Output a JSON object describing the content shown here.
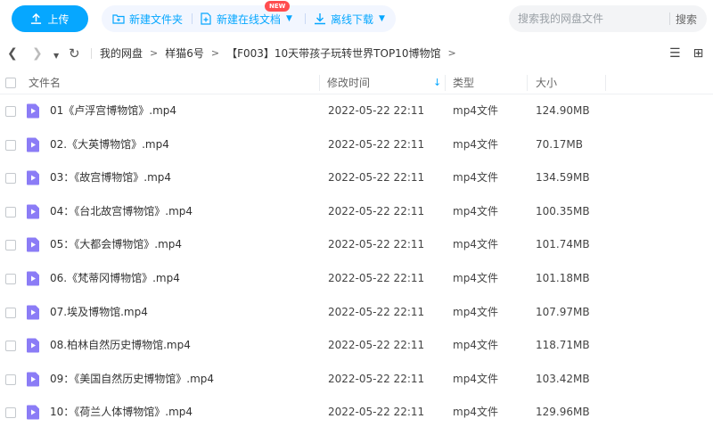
{
  "toolbar": {
    "upload_label": "上传",
    "new_folder_label": "新建文件夹",
    "new_doc_label": "新建在线文档",
    "new_badge": "NEW",
    "offline_label": "离线下载",
    "search_placeholder": "搜索我的网盘文件",
    "search_button": "搜索"
  },
  "breadcrumb": [
    "我的网盘",
    "样猫6号",
    "【F003】10天带孩子玩转世界TOP10博物馆"
  ],
  "columns": {
    "name": "文件名",
    "time": "修改时间",
    "type": "类型",
    "size": "大小"
  },
  "files": [
    {
      "name": "01《卢浮宫博物馆》.mp4",
      "time": "2022-05-22 22:11",
      "type": "mp4文件",
      "size": "124.90MB"
    },
    {
      "name": "02.《大英博物馆》.mp4",
      "time": "2022-05-22 22:11",
      "type": "mp4文件",
      "size": "70.17MB"
    },
    {
      "name": "03：《故宫博物馆》.mp4",
      "time": "2022-05-22 22:11",
      "type": "mp4文件",
      "size": "134.59MB"
    },
    {
      "name": "04：《台北故宫博物馆》.mp4",
      "time": "2022-05-22 22:11",
      "type": "mp4文件",
      "size": "100.35MB"
    },
    {
      "name": "05：《大都会博物馆》.mp4",
      "time": "2022-05-22 22:11",
      "type": "mp4文件",
      "size": "101.74MB"
    },
    {
      "name": "06.《梵蒂冈博物馆》.mp4",
      "time": "2022-05-22 22:11",
      "type": "mp4文件",
      "size": "101.18MB"
    },
    {
      "name": "07.埃及博物馆.mp4",
      "time": "2022-05-22 22:11",
      "type": "mp4文件",
      "size": "107.97MB"
    },
    {
      "name": "08.柏林自然历史博物馆.mp4",
      "time": "2022-05-22 22:11",
      "type": "mp4文件",
      "size": "118.71MB"
    },
    {
      "name": "09：《美国自然历史博物馆》.mp4",
      "time": "2022-05-22 22:11",
      "type": "mp4文件",
      "size": "103.42MB"
    },
    {
      "name": "10：《荷兰人体博物馆》.mp4",
      "time": "2022-05-22 22:11",
      "type": "mp4文件",
      "size": "129.96MB"
    }
  ],
  "colors": {
    "accent": "#06a7ff",
    "video_icon": "#8b7cf6"
  }
}
